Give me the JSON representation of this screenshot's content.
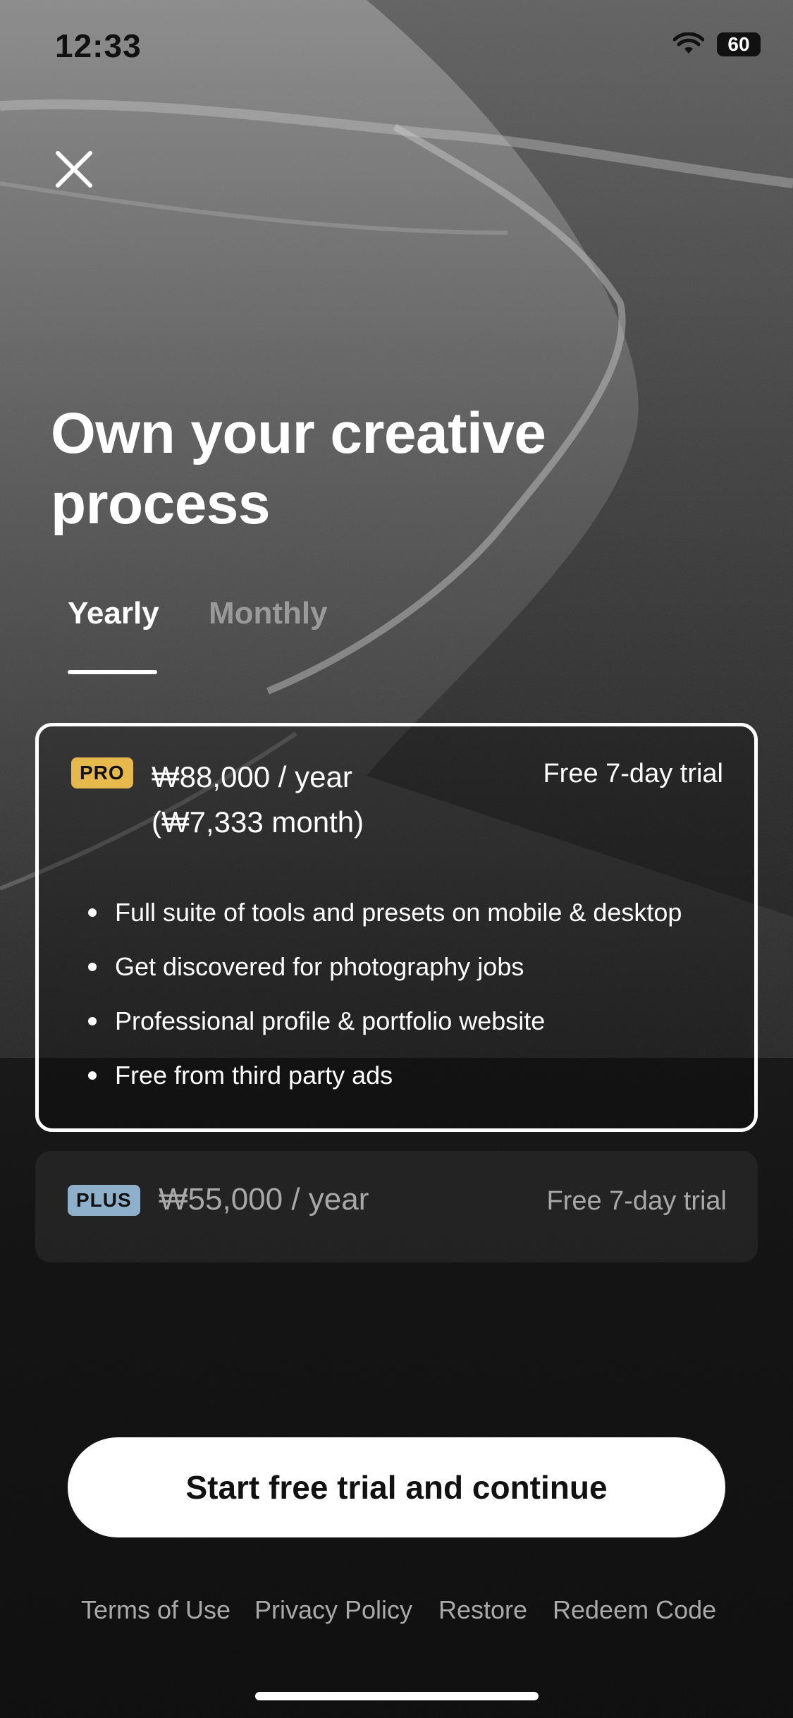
{
  "status_bar": {
    "time": "12:33",
    "battery": "60"
  },
  "headline": {
    "line1": "Own your creative",
    "line2": "process"
  },
  "tabs": [
    {
      "label": "Yearly",
      "selected": true
    },
    {
      "label": "Monthly",
      "selected": false
    }
  ],
  "plans": {
    "pro": {
      "badge": "PRO",
      "price_line1": "₩88,000 / year",
      "price_line2": "(₩7,333 month)",
      "trial": "Free 7-day trial",
      "features": [
        "Full suite of tools and presets on mobile & desktop",
        "Get discovered for photography jobs",
        "Professional profile & portfolio website",
        "Free from third party ads"
      ]
    },
    "plus": {
      "badge": "PLUS",
      "price": "₩55,000 / year",
      "trial": "Free 7-day trial"
    }
  },
  "cta_label": "Start free trial and continue",
  "footer_links": [
    "Terms of Use",
    "Privacy Policy",
    "Restore",
    "Redeem Code"
  ],
  "colors": {
    "pro_badge": "#e7b84b",
    "plus_badge": "#8fb0cb",
    "background": "#0c0c0c"
  }
}
